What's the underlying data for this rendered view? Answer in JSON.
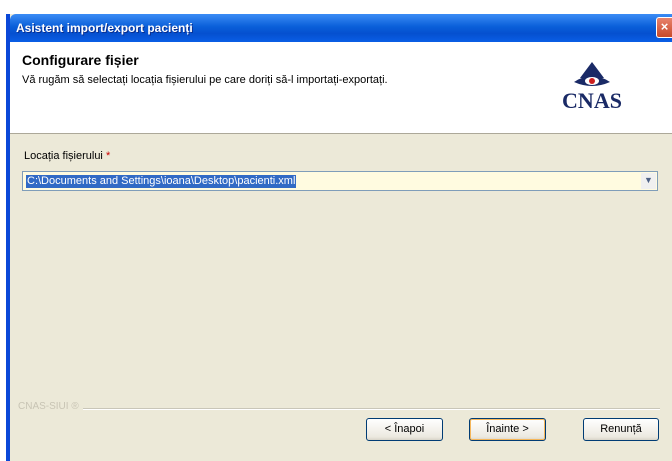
{
  "window": {
    "title": "Asistent import/export pacienți",
    "close_glyph": "×"
  },
  "header": {
    "title": "Configurare fișier",
    "description": "Vă rugăm să selectați locația fișierului pe care doriți să-l importați-exportați.",
    "logo_text": "CNAS"
  },
  "form": {
    "file_label": "Locația fișierului",
    "required_mark": "*",
    "file_value": "C:\\Documents and Settings\\ioana\\Desktop\\pacienti.xml",
    "combo_arrow": "▼"
  },
  "footer": {
    "group_caption": "CNAS-SIUI ®",
    "back_label": "< Înapoi",
    "next_label": "Înainte >",
    "cancel_label": "Renunță"
  },
  "colors": {
    "titlebar": "#0a5fd9",
    "dialog_bg": "#ece9d8",
    "selection": "#316ac5",
    "input_bg": "#fffbe0",
    "logo": "#1a2a66"
  },
  "icons": {
    "logo": "cnas-eye-logo-icon",
    "close": "close-icon",
    "dropdown": "chevron-down-icon"
  }
}
